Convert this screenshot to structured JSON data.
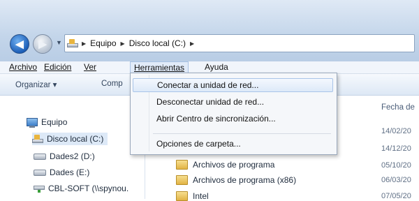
{
  "address": {
    "crumbs": [
      "Equipo",
      "Disco local (C:)"
    ]
  },
  "menubar": {
    "items": [
      "Archivo",
      "Edición",
      "Ver",
      "Herramientas",
      "Ayuda"
    ]
  },
  "toolbar": {
    "organize": "Organizar ▾",
    "share": "Comp"
  },
  "tools_menu": {
    "items": [
      "Conectar a unidad de red...",
      "Desconectar unidad de red...",
      "Abrir Centro de sincronización...",
      "Opciones de carpeta..."
    ]
  },
  "navpane": {
    "items": [
      {
        "label": "Equipo",
        "icon": "computer-icon"
      },
      {
        "label": "Disco local (C:)",
        "icon": "local-disk-icon"
      },
      {
        "label": "Dades2 (D:)",
        "icon": "drive-icon"
      },
      {
        "label": "Dades (E:)",
        "icon": "drive-icon"
      },
      {
        "label": "CBL-SOFT (\\\\spynou.",
        "icon": "network-drive-icon"
      }
    ]
  },
  "content": {
    "date_header": "Fecha de",
    "dates": [
      "14/02/20",
      "14/12/20",
      "05/10/20",
      "06/03/20",
      "07/05/20"
    ],
    "files": [
      "Archivos de programa",
      "Archivos de programa (x86)",
      "Intel"
    ]
  },
  "colors": {
    "accent": "#1d5fb8",
    "hover": "#dde9f8",
    "folder": "#e1b344"
  }
}
